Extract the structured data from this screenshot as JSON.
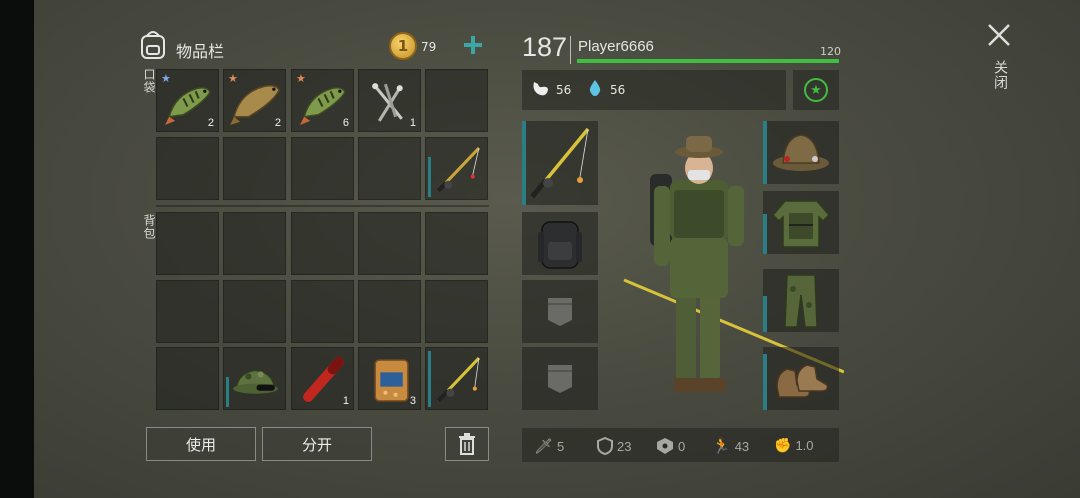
{
  "inventory": {
    "title": "物品栏",
    "coins": "79",
    "pocket_label": "口袋",
    "backpack_label": "背包",
    "pocket_items": [
      {
        "name": "perch-fish",
        "count": "2",
        "star_color": "#7ea7e8"
      },
      {
        "name": "carp-fish",
        "count": "2",
        "star_color": "#e08a5a"
      },
      {
        "name": "perch-fish",
        "count": "6",
        "star_color": "#e08a5a"
      },
      {
        "name": "nails",
        "count": "1"
      }
    ],
    "backpack_items": [
      {
        "name": "camo-hat-with-glasses"
      },
      {
        "name": "red-flare",
        "count": "1"
      },
      {
        "name": "fish-bait-bag",
        "count": "3"
      },
      {
        "name": "fishing-rod"
      }
    ],
    "use_button": "使用",
    "split_button": "分开"
  },
  "player": {
    "level": "187",
    "name": "Player6666",
    "health": "120",
    "hunger": "56",
    "thirst": "56"
  },
  "stats": {
    "attack": "5",
    "defense": "23",
    "radiation": "0",
    "speed": "43",
    "melee": "1.0"
  },
  "close_label": "关闭",
  "colors": {
    "accent_teal": "#3aa7a5",
    "health_green": "#3fbf3f",
    "durability": "#2a7f86"
  }
}
